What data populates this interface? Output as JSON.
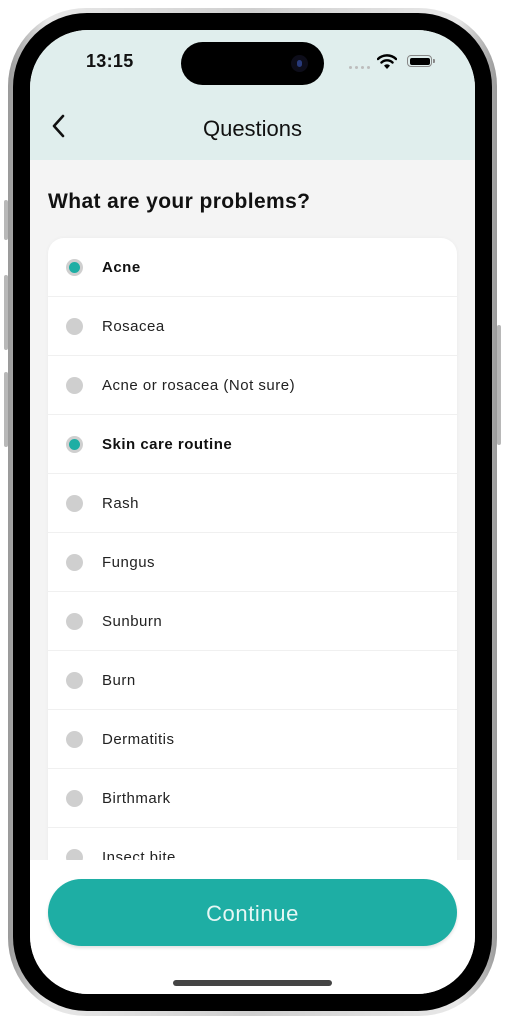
{
  "status_bar": {
    "time": "13:15"
  },
  "header": {
    "title": "Questions",
    "back_icon": "chevron-left-icon"
  },
  "question": "What are your problems?",
  "options": [
    {
      "label": "Acne",
      "selected": true
    },
    {
      "label": "Rosacea",
      "selected": false
    },
    {
      "label": "Acne or rosacea (Not sure)",
      "selected": false
    },
    {
      "label": "Skin care routine",
      "selected": true
    },
    {
      "label": "Rash",
      "selected": false
    },
    {
      "label": "Fungus",
      "selected": false
    },
    {
      "label": "Sunburn",
      "selected": false
    },
    {
      "label": "Burn",
      "selected": false
    },
    {
      "label": "Dermatitis",
      "selected": false
    },
    {
      "label": "Birthmark",
      "selected": false
    },
    {
      "label": "Insect bite",
      "selected": false
    }
  ],
  "footer": {
    "continue_label": "Continue"
  },
  "colors": {
    "accent": "#1eaea4",
    "header_bg": "#e0eeed",
    "radio_off": "#cfcfcf"
  }
}
